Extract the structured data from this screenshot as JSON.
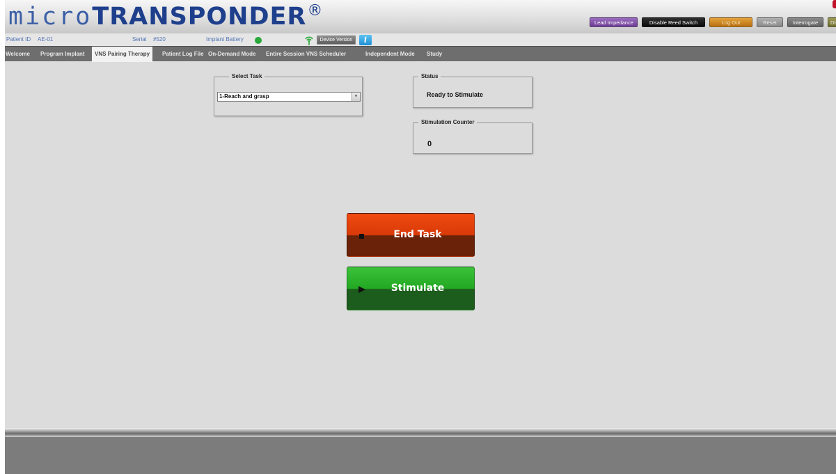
{
  "header": {
    "logo_micro": "micro",
    "logo_brand": "TRANSPONDER",
    "logo_reg": "®",
    "buttons": {
      "lead_impedance": "Lead Impedance",
      "disable_reed_switch": "Disable Reed Switch",
      "log_out": "Log Out",
      "reset": "Reset",
      "interrogate": "Interrogate",
      "disconnect": "Disconne"
    }
  },
  "infobar": {
    "patient_id_label": "Patient ID",
    "patient_id_value": "AE-01",
    "serial_label": "Serial",
    "serial_value": "#520",
    "battery_label": "Implant Battery",
    "battery_color": "#2aa83a",
    "device_version": "Device Version",
    "info_icon": "i"
  },
  "tabs": [
    {
      "label": "Welcome",
      "active": false
    },
    {
      "label": "Program Implant",
      "active": false
    },
    {
      "label": "VNS Pairing Therapy",
      "active": true
    },
    {
      "label": "Patient Log File",
      "active": false
    },
    {
      "label": "On-Demand Mode",
      "active": false
    },
    {
      "label": "Entire Session VNS Scheduler",
      "active": false
    },
    {
      "label": "Independent Mode",
      "active": false
    },
    {
      "label": "Study",
      "active": false
    }
  ],
  "select_task": {
    "legend": "Select Task",
    "selected": "1-Reach and grasp",
    "arrow": "▼"
  },
  "status": {
    "legend": "Status",
    "value": "Ready to Stimulate"
  },
  "counter": {
    "legend": "Stimulation Counter",
    "value": "0"
  },
  "actions": {
    "end_task": "End Task",
    "stimulate": "Stimulate"
  },
  "colors": {
    "brand_blue": "#1e3f8c",
    "end_task": "#d93a08",
    "stimulate": "#22a822"
  }
}
